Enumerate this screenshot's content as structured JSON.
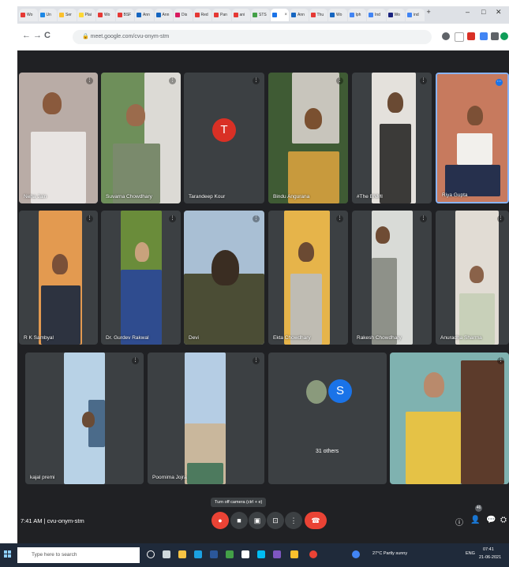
{
  "browser": {
    "tabs": [
      "Wo",
      "Un",
      "Ser",
      "Plai",
      "Wo",
      "BSF",
      "Ann",
      "Ann",
      "Dis",
      "Red",
      "Pan",
      "ani",
      "STS",
      "",
      "Ann",
      "Thu",
      "Wo",
      "Iph",
      "Ind",
      "Wo",
      "ind"
    ],
    "active_tab_index": 13,
    "new_tab": "+",
    "url": "meet.google.com/cvu-onym-stm",
    "back_icon": "←",
    "forward_icon": "→",
    "reload_icon": "C"
  },
  "tiles": [
    {
      "name": "Neha Jain"
    },
    {
      "name": "Suvarna Chowdhary"
    },
    {
      "name": "Tarandeep Kour",
      "avatar": "T"
    },
    {
      "name": "Bindu Angurana"
    },
    {
      "name": "#The BNMI"
    },
    {
      "name": "Riya Gupta"
    },
    {
      "name": "R K Sambyal"
    },
    {
      "name": "Dr. Gurdev Rakwal"
    },
    {
      "name": "Devi"
    },
    {
      "name": "Ekta Chowdhary"
    },
    {
      "name": "Rakesh Chowdhary"
    },
    {
      "name": "Anuradha Sharma"
    },
    {
      "name": "kajal premi"
    },
    {
      "name": "Poornima Jojra"
    },
    {
      "name": "31 others",
      "avatar": "S"
    },
    {
      "name": ""
    }
  ],
  "meeting": {
    "time": "7:41 AM",
    "separator": "|",
    "code": "cvu-onym-stm",
    "tooltip": "Turn off camera (ctrl + e)",
    "participant_badge": "46"
  },
  "taskbar": {
    "search_placeholder": "Type here to search",
    "weather": "27°C  Partly sunny",
    "lang": "ENG",
    "time": "07:41",
    "date": "21-06-2021"
  },
  "colors": {
    "meet_bg": "#202124",
    "tile_bg": "#3c4043",
    "end_call": "#ea4335",
    "avatar_T": "#d93025",
    "avatar_S": "#1a73e8"
  }
}
